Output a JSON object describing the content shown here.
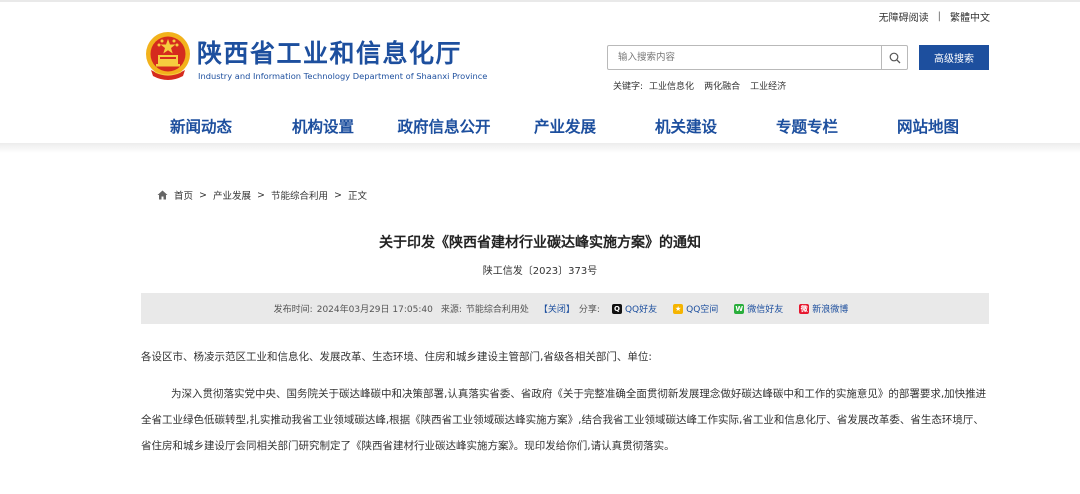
{
  "header": {
    "util_links": [
      "无障碍阅读",
      "繁體中文"
    ],
    "util_separator": "|",
    "brand_cn": "陕西省工业和信息化厅",
    "brand_en": "Industry and Information Technology Department of Shaanxi Province"
  },
  "search": {
    "placeholder": "输入搜索内容",
    "advanced_label": "高级搜索",
    "keywords_label": "关键字:",
    "keywords": [
      "工业信息化",
      "两化融合",
      "工业经济"
    ]
  },
  "nav": {
    "items": [
      "新闻动态",
      "机构设置",
      "政府信息公开",
      "产业发展",
      "机关建设",
      "专题专栏",
      "网站地图"
    ]
  },
  "breadcrumb": {
    "items": [
      "首页",
      "产业发展",
      "节能综合利用",
      "正文"
    ],
    "separator": ">"
  },
  "article": {
    "title": "关于印发《陕西省建材行业碳达峰实施方案》的通知",
    "doc_number": "陕工信发〔2023〕373号",
    "meta": {
      "publish_label": "发布时间:",
      "publish_time": "2024年03月29日 17:05:40",
      "source_label": "来源:",
      "source": "节能综合利用处",
      "close_label": "【关闭】",
      "share_label": "分享:",
      "share_targets": [
        "QQ好友",
        "QQ空间",
        "微信好友",
        "新浪微博"
      ]
    },
    "salutation": "各设区市、杨凌示范区工业和信息化、发展改革、生态环境、住房和城乡建设主管部门,省级各相关部门、单位:",
    "paragraph1": "为深入贯彻落实党中央、国务院关于碳达峰碳中和决策部署,认真落实省委、省政府《关于完整准确全面贯彻新发展理念做好碳达峰碳中和工作的实施意见》的部署要求,加快推进全省工业绿色低碳转型,扎实推动我省工业领域碳达峰,根据《陕西省工业领域碳达峰实施方案》,结合我省工业领域碳达峰工作实际,省工业和信息化厅、省发展改革委、省生态环境厅、省住房和城乡建设厅会同相关部门研究制定了《陕西省建材行业碳达峰实施方案》。现印发给你们,请认真贯彻落实。"
  },
  "colors": {
    "brand_blue": "#1d4f9e",
    "meta_bar": "#e9e9e9"
  },
  "icons": [
    "home-icon",
    "search-icon",
    "national-emblem",
    "qq-icon",
    "qzone-icon",
    "wechat-icon",
    "weibo-icon"
  ]
}
